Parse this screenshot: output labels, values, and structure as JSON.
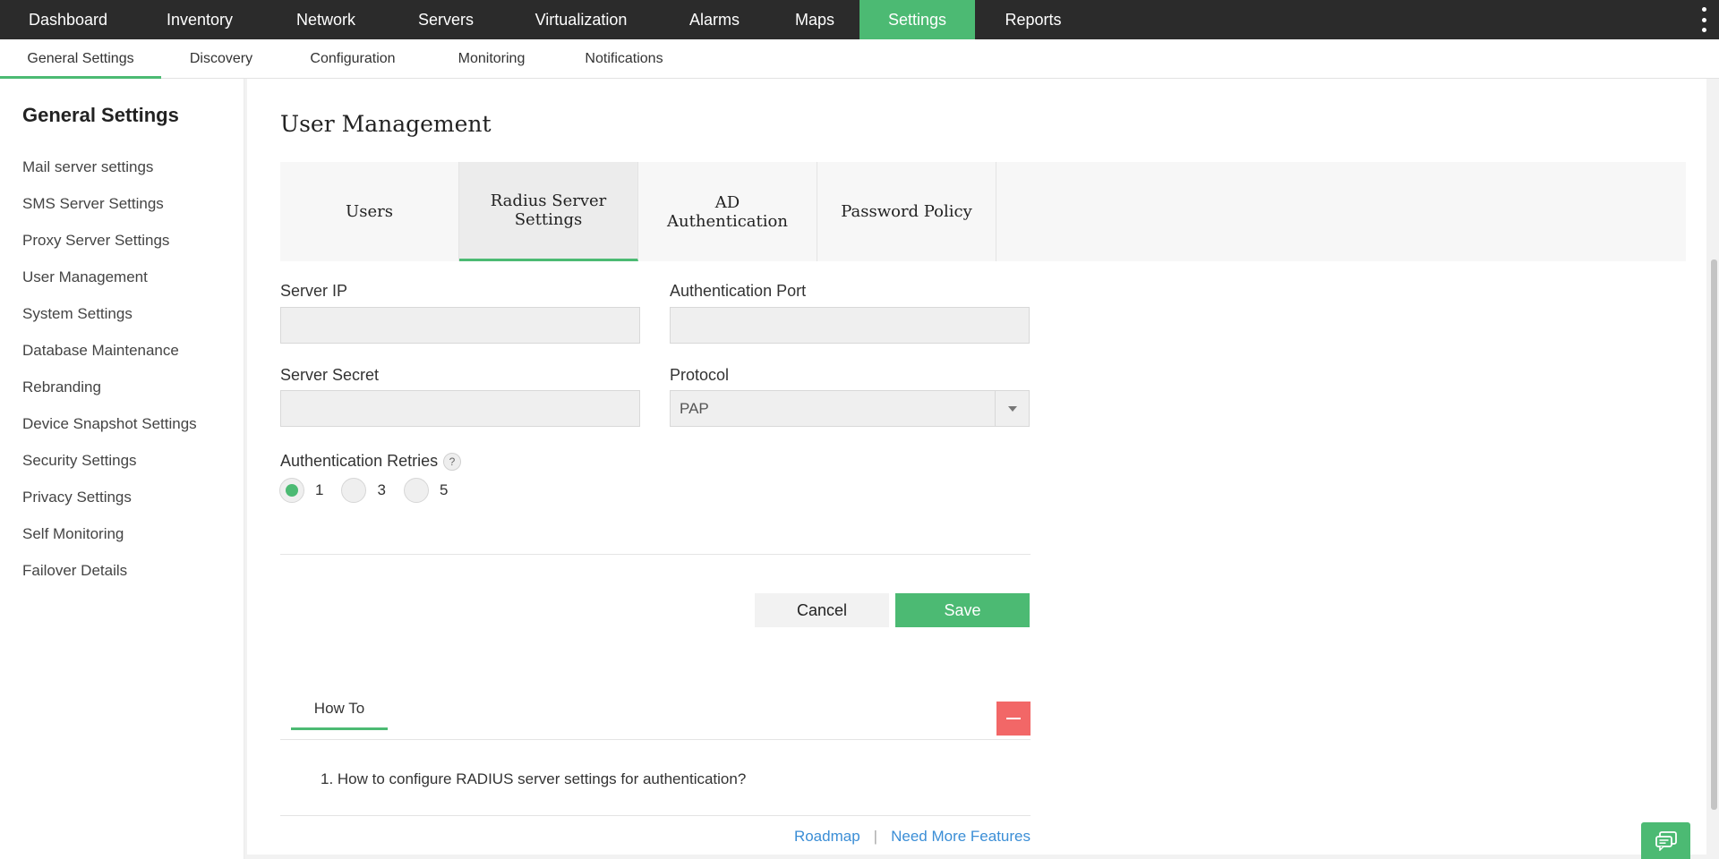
{
  "top_nav": {
    "items": [
      "Dashboard",
      "Inventory",
      "Network",
      "Servers",
      "Virtualization",
      "Alarms",
      "Maps",
      "Settings",
      "Reports"
    ],
    "active": "Settings"
  },
  "sub_nav": {
    "items": [
      "General Settings",
      "Discovery",
      "Configuration",
      "Monitoring",
      "Notifications"
    ],
    "active": "General Settings"
  },
  "sidebar": {
    "title": "General Settings",
    "items": [
      "Mail server settings",
      "SMS Server Settings",
      "Proxy Server Settings",
      "User Management",
      "System Settings",
      "Database Maintenance",
      "Rebranding",
      "Device Snapshot Settings",
      "Security Settings",
      "Privacy Settings",
      "Self Monitoring",
      "Failover Details"
    ]
  },
  "main": {
    "title": "User Management",
    "tabs": [
      "Users",
      "Radius Server Settings",
      "AD Authentication",
      "Password Policy"
    ],
    "active_tab": "Radius Server Settings",
    "form": {
      "server_ip_label": "Server IP",
      "server_ip_value": "",
      "auth_port_label": "Authentication Port",
      "auth_port_value": "",
      "server_secret_label": "Server Secret",
      "server_secret_value": "",
      "protocol_label": "Protocol",
      "protocol_value": "PAP",
      "retries_label": "Authentication Retries",
      "retries_help": "?",
      "retries_options": [
        "1",
        "3",
        "5"
      ],
      "retries_selected": "1"
    },
    "buttons": {
      "cancel": "Cancel",
      "save": "Save"
    },
    "howto": {
      "tab_label": "How To",
      "items": [
        "1. How to configure RADIUS server settings for authentication?"
      ]
    },
    "footer": {
      "roadmap": "Roadmap",
      "separator": "|",
      "more_features": "Need More Features"
    }
  },
  "colors": {
    "accent": "#4cba73",
    "topnav_bg": "#2b2b2b",
    "collapse": "#f26767",
    "link": "#3b8ed6"
  }
}
